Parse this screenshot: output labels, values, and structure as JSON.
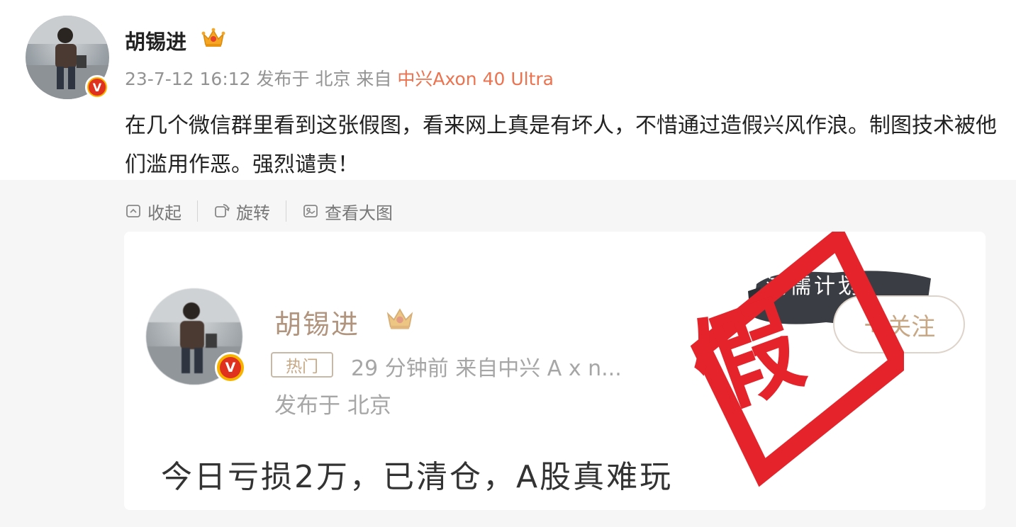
{
  "post": {
    "username": "胡锡进",
    "meta_time_location": "23-7-12 16:12 发布于 北京 来自 ",
    "source": "中兴Axon 40 Ultra",
    "verified_mark": "V",
    "text": "在几个微信群里看到这张假图，看来网上真是有坏人，不惜通过造假兴风作浪。制图技术被他们滥用作恶。强烈谴责！"
  },
  "toolbar": {
    "collapse_label": "收起",
    "rotate_label": "旋转",
    "view_large_label": "查看大图"
  },
  "image": {
    "inner_username": "胡锡进",
    "inner_verified_mark": "V",
    "hot_badge": "热门",
    "inner_meta": "29 分钟前 来自中兴 A x  n...",
    "inner_meta_line2": "发布于 北京",
    "banner_text": "鸿儒计划",
    "follow_label": "关注",
    "follow_icon": "+",
    "content": "今日亏损2万，已清仓，A股真难玩",
    "stamp_text": "假"
  },
  "colors": {
    "source": "#eb7350",
    "stamp_red": "#e4232b",
    "toolbar_text": "#777777",
    "gray_area": "#f6f6f6"
  }
}
